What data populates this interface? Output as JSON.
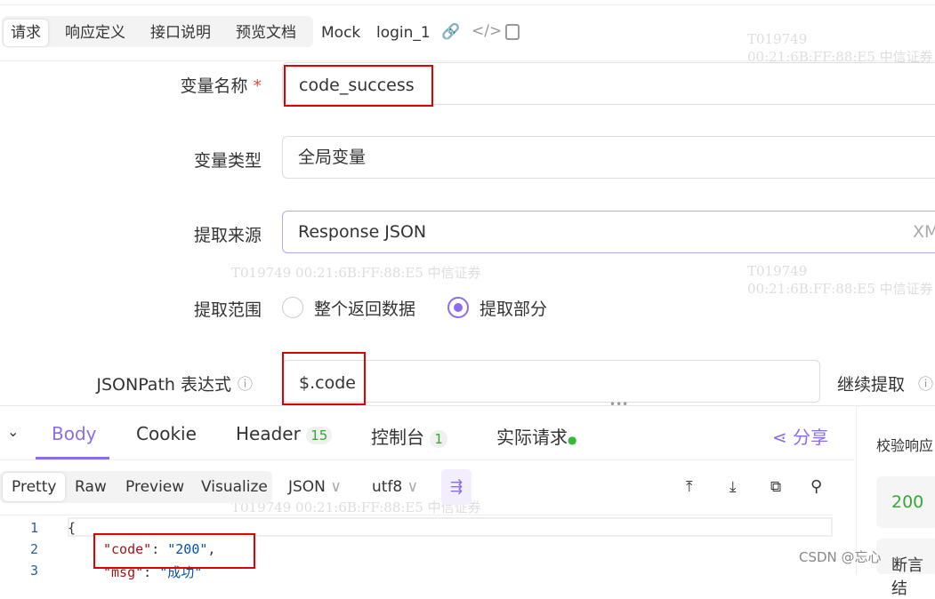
{
  "tabs": [
    "请求",
    "响应定义",
    "接口说明",
    "预览文档",
    "Mock"
  ],
  "api_name": "login_1",
  "form": {
    "var_name_label": "变量名称",
    "var_name": "code_success",
    "var_type_label": "变量类型",
    "var_type": "全局变量",
    "source_label": "提取来源",
    "source": "Response JSON",
    "source_right": "XM",
    "scope_label": "提取范围",
    "scope_options": [
      "整个返回数据",
      "提取部分"
    ],
    "scope_selected": 1,
    "jsonpath_label": "JSONPath 表达式",
    "jsonpath": "$.code",
    "continue": "继续提取"
  },
  "watermark": "T019749   00:21:6B:FF:88:E5   中信证券",
  "response": {
    "tabs": [
      "Body",
      "Cookie",
      "Header",
      "控制台",
      "实际请求"
    ],
    "header_count": "15",
    "console_count": "1",
    "share": "分享",
    "views": [
      "Pretty",
      "Raw",
      "Preview",
      "Visualize"
    ],
    "format": "JSON",
    "encoding": "utf8",
    "lines": [
      {
        "n": "1",
        "t": "{"
      },
      {
        "n": "2",
        "k": "\"code\"",
        "v": "\"200\""
      },
      {
        "n": "3",
        "k": "\"msg\"",
        "v": "\"成功\""
      }
    ]
  },
  "side": {
    "title": "校验响应",
    "status": "200",
    "assert": "断言结"
  },
  "credit": "CSDN @忘心"
}
